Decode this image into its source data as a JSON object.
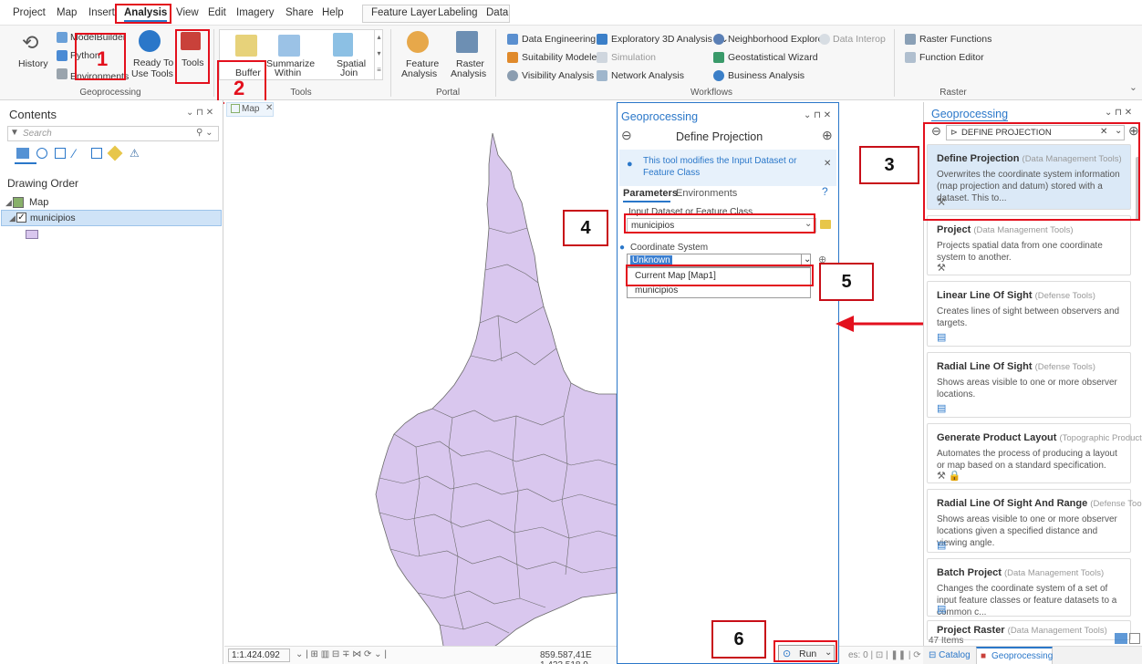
{
  "menu": {
    "items": [
      "Project",
      "Map",
      "Insert",
      "Analysis",
      "View",
      "Edit",
      "Imagery",
      "Share",
      "Help",
      "Feature Layer",
      "Labeling",
      "Data"
    ],
    "active": "Analysis"
  },
  "ribbon": {
    "geoprocessing": {
      "history": "History",
      "modelbuilder": "ModelBuilder",
      "python": "Python",
      "environments": "Environments",
      "ready_to_use_1": "Ready To",
      "ready_to_use_2": "Use Tools",
      "tools": "Tools",
      "label": "Geoprocessing"
    },
    "tools": {
      "buffer": "Buffer",
      "summarize_1": "Summarize",
      "summarize_2": "Within",
      "spatial_1": "Spatial",
      "spatial_2": "Join",
      "label": "Tools"
    },
    "portal": {
      "feature_1": "Feature",
      "feature_2": "Analysis",
      "raster_1": "Raster",
      "raster_2": "Analysis",
      "label": "Portal"
    },
    "workflows": {
      "data_engineering": "Data Engineering",
      "exploratory_3d": "Exploratory 3D Analysis",
      "neighborhood_explorer": "Neighborhood Explorer",
      "data_interop": "Data Interop",
      "suitability_modeler": "Suitability Modeler",
      "simulation": "Simulation",
      "geostatistical_wizard": "Geostatistical Wizard",
      "visibility_analysis": "Visibility Analysis",
      "network_analysis": "Network Analysis",
      "business_analysis": "Business Analysis",
      "label": "Workflows"
    },
    "raster": {
      "raster_functions": "Raster Functions",
      "function_editor": "Function Editor",
      "label": "Raster"
    }
  },
  "contents": {
    "title": "Contents",
    "search_placeholder": "Search",
    "drawing_order": "Drawing Order",
    "map_label": "Map",
    "layer_label": "municipios"
  },
  "map_tab": {
    "label": "Map"
  },
  "statusbar": {
    "scale": "1:1.424.092",
    "coords": "859.587,41E 1.423.518,9"
  },
  "gp_tool": {
    "header": "Geoprocessing",
    "title": "Define Projection",
    "info": "This tool modifies the Input Dataset or Feature Class",
    "tab_parameters": "Parameters",
    "tab_environments": "Environments",
    "input_label": "Input Dataset or Feature Class",
    "input_value": "municipios",
    "cs_label": "Coordinate System",
    "cs_value": "Unknown",
    "dropdown_options": [
      "Current Map [Map1]",
      "municipios"
    ],
    "run": "Run"
  },
  "gp_search": {
    "header": "Geoprocessing",
    "query": "DEFINE PROJECTION",
    "results": [
      {
        "name": "Define Projection",
        "source": "(Data Management Tools)",
        "desc": "Overwrites the coordinate system information (map projection and datum) stored with a dataset. This to..."
      },
      {
        "name": "Project",
        "source": "(Data Management Tools)",
        "desc": "Projects spatial data from one coordinate system to another."
      },
      {
        "name": "Linear Line Of Sight",
        "source": "(Defense Tools)",
        "desc": "Creates lines of sight between observers and targets."
      },
      {
        "name": "Radial Line Of Sight",
        "source": "(Defense Tools)",
        "desc": "Shows  areas visible to one or more observer locations."
      },
      {
        "name": "Generate Product Layout",
        "source": "(Topographic Production...",
        "desc": "Automates the process of producing a layout or map based on a standard specification."
      },
      {
        "name": "Radial Line Of Sight And Range",
        "source": "(Defense Tools)",
        "desc": "Shows  areas visible to one or more observer locations given a specified distance and viewing angle."
      },
      {
        "name": "Batch Project",
        "source": "(Data Management Tools)",
        "desc": "Changes the coordinate system of a set of input feature classes or feature datasets to a common c..."
      },
      {
        "name": "Project Raster",
        "source": "(Data Management Tools)",
        "desc": ""
      }
    ],
    "count": "47 Items",
    "tab_catalog": "Catalog",
    "tab_geoprocessing": "Geoprocessing"
  },
  "annotations": [
    "1",
    "2",
    "3",
    "4",
    "5",
    "6"
  ],
  "colors": {
    "accent": "#2a77c9",
    "annotation_red": "#e3101d",
    "polygon_fill": "#d9c7ee",
    "polygon_stroke": "#6a6a6a"
  }
}
